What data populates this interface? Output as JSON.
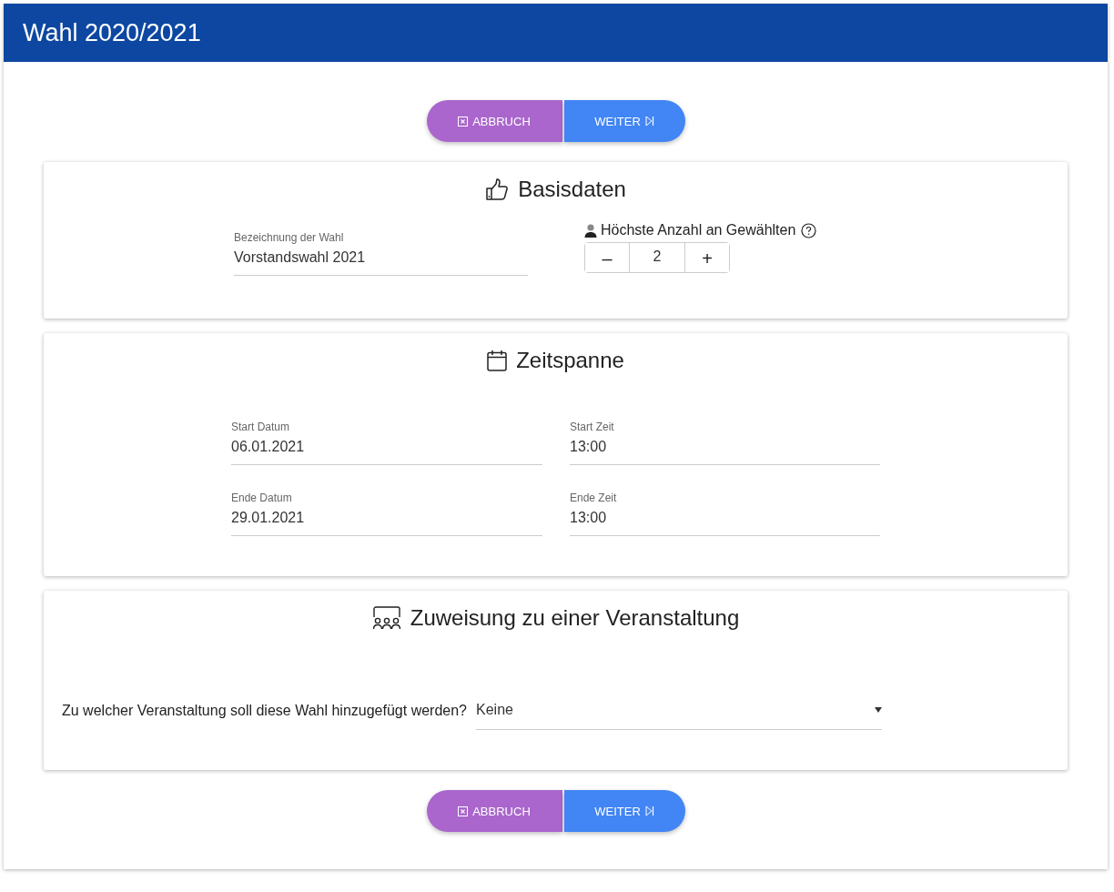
{
  "header": {
    "title": "Wahl 2020/2021"
  },
  "top_actions": [
    {
      "kind": "cancel",
      "label": "ABBRUCH"
    },
    {
      "kind": "next",
      "label": "WEITER"
    }
  ],
  "basisdaten": {
    "title": "Basisdaten",
    "name_field": {
      "label": "Bezeichnung der Wahl",
      "value": "Vorstandswahl 2021"
    },
    "max_elected": {
      "label": "Höchste Anzahl an Gewählten",
      "minus": "–",
      "value": "2",
      "plus": "+"
    }
  },
  "zeitspanne": {
    "title": "Zeitspanne",
    "fields": [
      {
        "label": "Start Datum",
        "value": "06.01.2021"
      },
      {
        "label": "Start Zeit",
        "value": "13:00"
      },
      {
        "label": "Ende Datum",
        "value": "29.01.2021"
      },
      {
        "label": "Ende Zeit",
        "value": "13:00"
      }
    ]
  },
  "zuweisung": {
    "title": "Zuweisung zu einer Veranstaltung",
    "question": "Zu welcher Veranstaltung soll diese Wahl hinzugefügt werden?",
    "select_value": "Keine"
  },
  "bottom_actions": [
    {
      "kind": "cancel",
      "label": "ABBRUCH"
    },
    {
      "kind": "next",
      "label": "WEITER"
    }
  ]
}
